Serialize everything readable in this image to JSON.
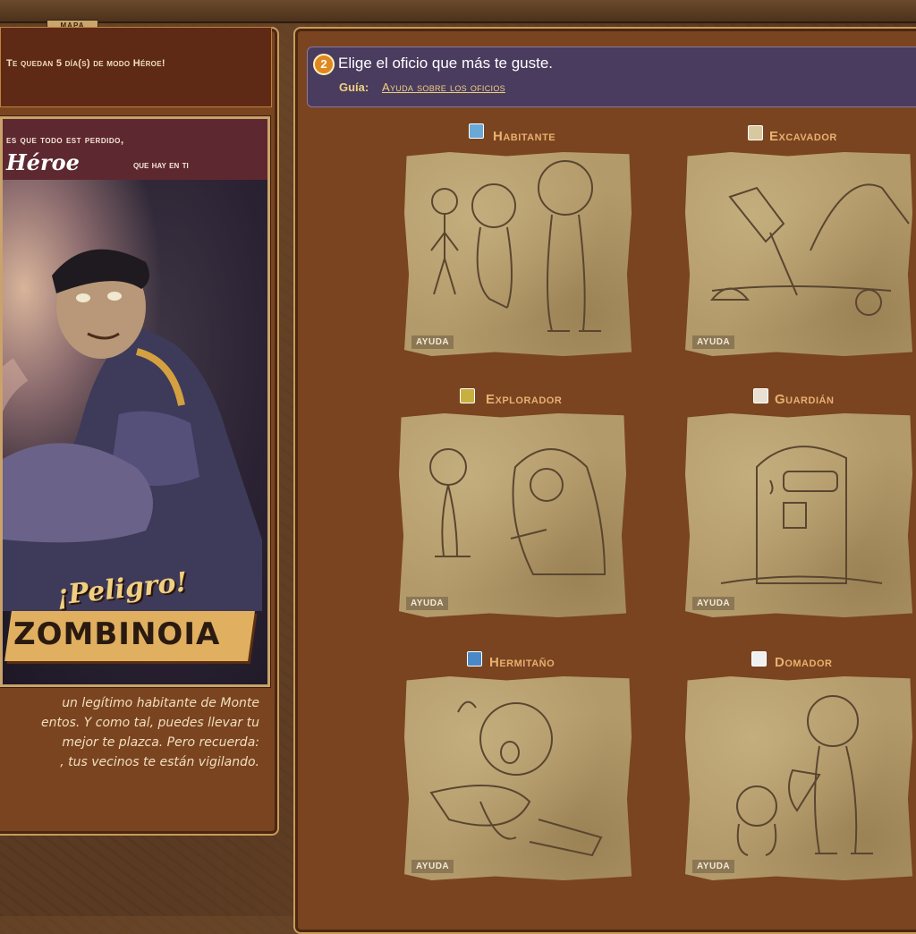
{
  "top_tab": "MAPA",
  "left": {
    "hero_notice": "Te quedan 5 día(s) de modo Héroe!",
    "poster": {
      "line1": "es que todo est perdido,",
      "heroe": "Héroe",
      "line2": "que hay en ti",
      "peligro": "¡Peligro!",
      "title": "ZOMBINOIA"
    },
    "intro_lines": [
      "un legítimo habitante de Monte",
      "entos. Y como tal, puedes llevar tu",
      "mejor te plazca. Pero recuerda:",
      ", tus vecinos te están vigilando."
    ]
  },
  "main": {
    "step_number": "2",
    "prompt": "Elige el oficio que más te guste.",
    "guide_label": "Guía:",
    "guide_link": "Ayuda sobre los oficios",
    "jobs": [
      {
        "title": "Habitante",
        "icon": "citizen-icon",
        "help": "AYUDA"
      },
      {
        "title": "Excavador",
        "icon": "shovel-icon",
        "help": "AYUDA"
      },
      {
        "title": "Explorador",
        "icon": "explorer-hood-icon",
        "help": "AYUDA"
      },
      {
        "title": "Guardián",
        "icon": "shield-icon",
        "help": "AYUDA"
      },
      {
        "title": "Hermitaño",
        "icon": "hermit-icon",
        "help": "AYUDA"
      },
      {
        "title": "Domador",
        "icon": "dog-icon",
        "help": "AYUDA"
      }
    ]
  },
  "colors": {
    "panel": "#7a4420",
    "prompt_bg": "#4a3c5e",
    "job_title": "#e8b070",
    "card": "#b39a6a"
  }
}
